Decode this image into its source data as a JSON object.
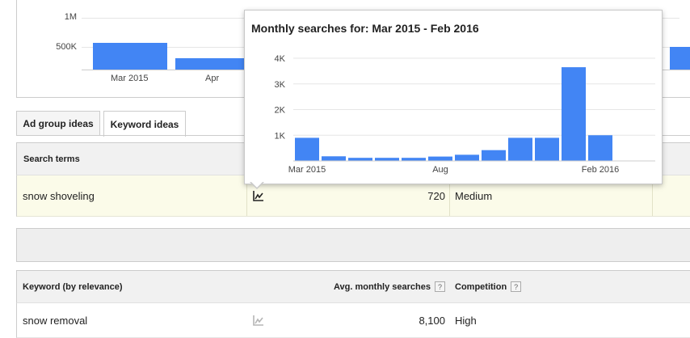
{
  "background_chart": {
    "y_ticks": [
      "1M",
      "500K"
    ],
    "x_labels": [
      "Mar 2015",
      "Apr"
    ],
    "bar_color": "#4285f4"
  },
  "tabs": [
    {
      "label": "Ad group ideas",
      "active": false
    },
    {
      "label": "Keyword ideas",
      "active": true
    }
  ],
  "search_terms_table": {
    "header": "Search terms",
    "rows": [
      {
        "keyword": "snow shoveling",
        "avg_monthly_searches": "720",
        "competition": "Medium"
      }
    ]
  },
  "keyword_ideas_table": {
    "headers": {
      "keyword": "Keyword (by relevance)",
      "avg_monthly_searches": "Avg. monthly searches",
      "competition": "Competition",
      "help": "?"
    },
    "rows": [
      {
        "keyword": "snow removal",
        "avg_monthly_searches": "8,100",
        "competition": "High"
      }
    ]
  },
  "tooltip": {
    "title": "Monthly searches for: Mar 2015 - Feb 2016"
  },
  "chart_data": {
    "type": "bar",
    "title": "Monthly searches for: Mar 2015 - Feb 2016",
    "categories": [
      "Mar 2015",
      "Apr 2015",
      "May 2015",
      "Jun 2015",
      "Jul 2015",
      "Aug 2015",
      "Sep 2015",
      "Oct 2015",
      "Nov 2015",
      "Dec 2015",
      "Jan 2016",
      "Feb 2016"
    ],
    "values": [
      900,
      180,
      120,
      120,
      120,
      170,
      240,
      420,
      900,
      900,
      3650,
      1000
    ],
    "x_tick_labels": [
      "Mar 2015",
      "Aug",
      "Feb 2016"
    ],
    "y_tick_labels": [
      "1K",
      "2K",
      "3K",
      "4K"
    ],
    "ylim": [
      0,
      4000
    ],
    "grid": true,
    "bar_color": "#4285f4"
  },
  "colors": {
    "accent": "#4285f4",
    "highlight_row": "#fbfbe9"
  },
  "icons": {
    "trend_active": "trend-chart-icon",
    "trend_inactive": "trend-chart-icon"
  }
}
